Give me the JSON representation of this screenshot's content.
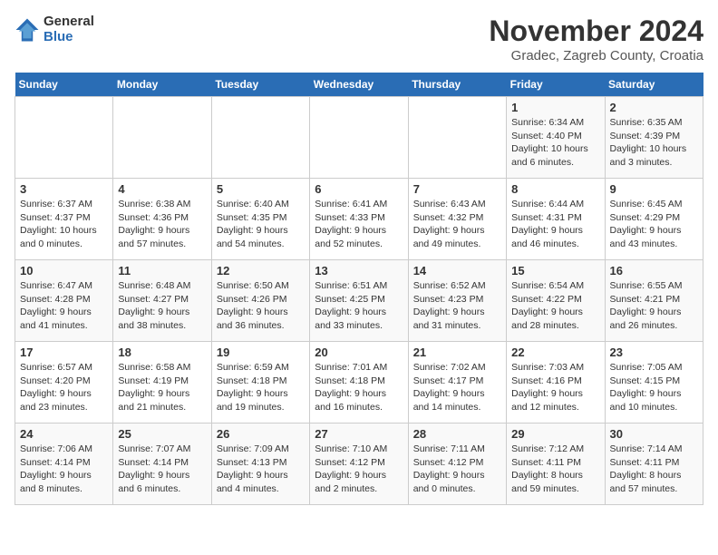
{
  "logo": {
    "general": "General",
    "blue": "Blue"
  },
  "title": "November 2024",
  "subtitle": "Gradec, Zagreb County, Croatia",
  "weekdays": [
    "Sunday",
    "Monday",
    "Tuesday",
    "Wednesday",
    "Thursday",
    "Friday",
    "Saturday"
  ],
  "weeks": [
    [
      {
        "day": "",
        "info": ""
      },
      {
        "day": "",
        "info": ""
      },
      {
        "day": "",
        "info": ""
      },
      {
        "day": "",
        "info": ""
      },
      {
        "day": "",
        "info": ""
      },
      {
        "day": "1",
        "info": "Sunrise: 6:34 AM\nSunset: 4:40 PM\nDaylight: 10 hours and 6 minutes."
      },
      {
        "day": "2",
        "info": "Sunrise: 6:35 AM\nSunset: 4:39 PM\nDaylight: 10 hours and 3 minutes."
      }
    ],
    [
      {
        "day": "3",
        "info": "Sunrise: 6:37 AM\nSunset: 4:37 PM\nDaylight: 10 hours and 0 minutes."
      },
      {
        "day": "4",
        "info": "Sunrise: 6:38 AM\nSunset: 4:36 PM\nDaylight: 9 hours and 57 minutes."
      },
      {
        "day": "5",
        "info": "Sunrise: 6:40 AM\nSunset: 4:35 PM\nDaylight: 9 hours and 54 minutes."
      },
      {
        "day": "6",
        "info": "Sunrise: 6:41 AM\nSunset: 4:33 PM\nDaylight: 9 hours and 52 minutes."
      },
      {
        "day": "7",
        "info": "Sunrise: 6:43 AM\nSunset: 4:32 PM\nDaylight: 9 hours and 49 minutes."
      },
      {
        "day": "8",
        "info": "Sunrise: 6:44 AM\nSunset: 4:31 PM\nDaylight: 9 hours and 46 minutes."
      },
      {
        "day": "9",
        "info": "Sunrise: 6:45 AM\nSunset: 4:29 PM\nDaylight: 9 hours and 43 minutes."
      }
    ],
    [
      {
        "day": "10",
        "info": "Sunrise: 6:47 AM\nSunset: 4:28 PM\nDaylight: 9 hours and 41 minutes."
      },
      {
        "day": "11",
        "info": "Sunrise: 6:48 AM\nSunset: 4:27 PM\nDaylight: 9 hours and 38 minutes."
      },
      {
        "day": "12",
        "info": "Sunrise: 6:50 AM\nSunset: 4:26 PM\nDaylight: 9 hours and 36 minutes."
      },
      {
        "day": "13",
        "info": "Sunrise: 6:51 AM\nSunset: 4:25 PM\nDaylight: 9 hours and 33 minutes."
      },
      {
        "day": "14",
        "info": "Sunrise: 6:52 AM\nSunset: 4:23 PM\nDaylight: 9 hours and 31 minutes."
      },
      {
        "day": "15",
        "info": "Sunrise: 6:54 AM\nSunset: 4:22 PM\nDaylight: 9 hours and 28 minutes."
      },
      {
        "day": "16",
        "info": "Sunrise: 6:55 AM\nSunset: 4:21 PM\nDaylight: 9 hours and 26 minutes."
      }
    ],
    [
      {
        "day": "17",
        "info": "Sunrise: 6:57 AM\nSunset: 4:20 PM\nDaylight: 9 hours and 23 minutes."
      },
      {
        "day": "18",
        "info": "Sunrise: 6:58 AM\nSunset: 4:19 PM\nDaylight: 9 hours and 21 minutes."
      },
      {
        "day": "19",
        "info": "Sunrise: 6:59 AM\nSunset: 4:18 PM\nDaylight: 9 hours and 19 minutes."
      },
      {
        "day": "20",
        "info": "Sunrise: 7:01 AM\nSunset: 4:18 PM\nDaylight: 9 hours and 16 minutes."
      },
      {
        "day": "21",
        "info": "Sunrise: 7:02 AM\nSunset: 4:17 PM\nDaylight: 9 hours and 14 minutes."
      },
      {
        "day": "22",
        "info": "Sunrise: 7:03 AM\nSunset: 4:16 PM\nDaylight: 9 hours and 12 minutes."
      },
      {
        "day": "23",
        "info": "Sunrise: 7:05 AM\nSunset: 4:15 PM\nDaylight: 9 hours and 10 minutes."
      }
    ],
    [
      {
        "day": "24",
        "info": "Sunrise: 7:06 AM\nSunset: 4:14 PM\nDaylight: 9 hours and 8 minutes."
      },
      {
        "day": "25",
        "info": "Sunrise: 7:07 AM\nSunset: 4:14 PM\nDaylight: 9 hours and 6 minutes."
      },
      {
        "day": "26",
        "info": "Sunrise: 7:09 AM\nSunset: 4:13 PM\nDaylight: 9 hours and 4 minutes."
      },
      {
        "day": "27",
        "info": "Sunrise: 7:10 AM\nSunset: 4:12 PM\nDaylight: 9 hours and 2 minutes."
      },
      {
        "day": "28",
        "info": "Sunrise: 7:11 AM\nSunset: 4:12 PM\nDaylight: 9 hours and 0 minutes."
      },
      {
        "day": "29",
        "info": "Sunrise: 7:12 AM\nSunset: 4:11 PM\nDaylight: 8 hours and 59 minutes."
      },
      {
        "day": "30",
        "info": "Sunrise: 7:14 AM\nSunset: 4:11 PM\nDaylight: 8 hours and 57 minutes."
      }
    ]
  ]
}
